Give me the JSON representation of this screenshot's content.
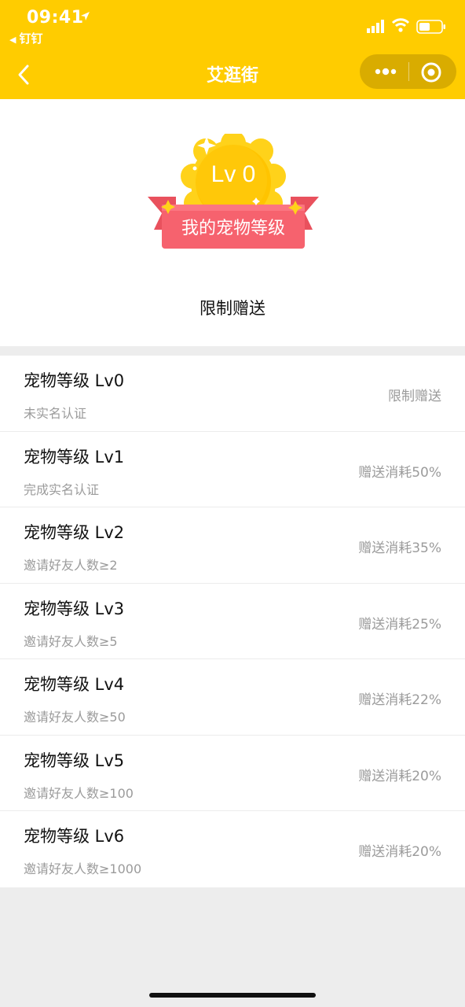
{
  "status_bar": {
    "time": "09:41",
    "back_app": "钉钉"
  },
  "nav": {
    "title": "艾逛街"
  },
  "hero": {
    "badge_level": "Lv 0",
    "ribbon_text": "我的宠物等级",
    "status_text": "限制赠送"
  },
  "levels": [
    {
      "title": "宠物等级 Lv0",
      "requirement": "未实名认证",
      "benefit": "限制赠送"
    },
    {
      "title": "宠物等级 Lv1",
      "requirement": "完成实名认证",
      "benefit": "赠送消耗50%"
    },
    {
      "title": "宠物等级 Lv2",
      "requirement": "邀请好友人数≥2",
      "benefit": "赠送消耗35%"
    },
    {
      "title": "宠物等级 Lv3",
      "requirement": "邀请好友人数≥5",
      "benefit": "赠送消耗25%"
    },
    {
      "title": "宠物等级 Lv4",
      "requirement": "邀请好友人数≥50",
      "benefit": "赠送消耗22%"
    },
    {
      "title": "宠物等级 Lv5",
      "requirement": "邀请好友人数≥100",
      "benefit": "赠送消耗20%"
    },
    {
      "title": "宠物等级 Lv6",
      "requirement": "邀请好友人数≥1000",
      "benefit": "赠送消耗20%"
    }
  ],
  "colors": {
    "brand_yellow": "#ffcc00",
    "ribbon_red": "#f6626e",
    "medal_gold": "#ffc400"
  },
  "icons": {
    "status": [
      "location-arrow-icon",
      "signal-icon",
      "wifi-icon",
      "battery-icon"
    ],
    "nav": [
      "back-chevron-icon",
      "more-dots-icon",
      "close-target-icon"
    ]
  }
}
